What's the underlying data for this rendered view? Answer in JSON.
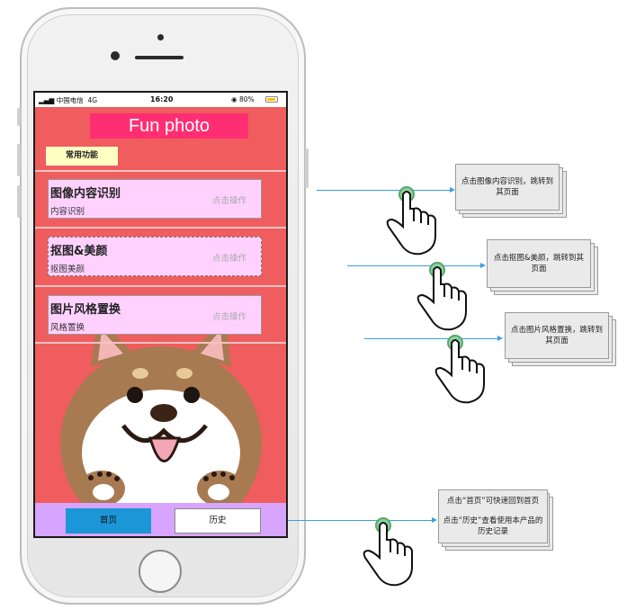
{
  "status_bar": {
    "carrier": "中国电信",
    "network": "4G",
    "time": "16:20",
    "battery": "80%"
  },
  "app": {
    "title": "Fun photo",
    "section_tag": "常用功能"
  },
  "cards": [
    {
      "title": "图像内容识别",
      "subtitle": "内容识别",
      "action": "点击操作"
    },
    {
      "title": "抠图&美颜",
      "subtitle": "抠图美颜",
      "action": "点击操作"
    },
    {
      "title": "图片风格置换",
      "subtitle": "风格置换",
      "action": "点击操作"
    }
  ],
  "tabs": {
    "home": "首页",
    "history": "历史"
  },
  "annotations": [
    {
      "text": "点击图像内容识别，跳转到其页面"
    },
    {
      "text": "点击抠图&美颜，跳转到其页面"
    },
    {
      "text": "点击图片风格置换，跳转到其页面"
    },
    {
      "line1": "点击“首页”可快速回到首页",
      "line2": "点击“历史”查看使用本产品的历史记录"
    }
  ],
  "colors": {
    "screen_bg": "#f05d5e",
    "title_bg": "#ff2e73",
    "card_bg": "#ffd1ff",
    "tabbar_bg": "#d7a4ff",
    "home_tab": "#1b96d6",
    "line": "#3a9fe0"
  }
}
